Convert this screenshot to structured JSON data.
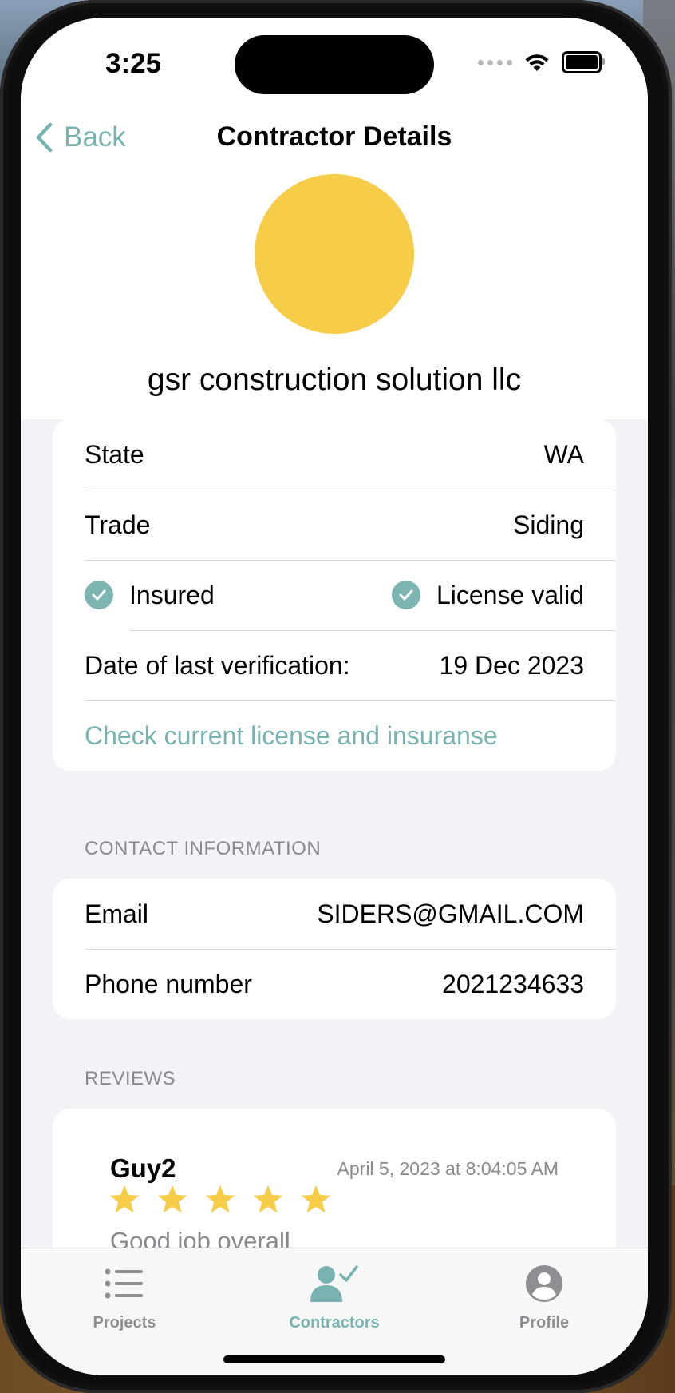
{
  "status_bar": {
    "time": "3:25"
  },
  "nav": {
    "back_label": "Back",
    "title": "Contractor Details"
  },
  "contractor": {
    "name": "gsr construction solution llc",
    "avatar_color": "#f6cc48"
  },
  "details": {
    "state_label": "State",
    "state_value": "WA",
    "trade_label": "Trade",
    "trade_value": "Siding",
    "insured_label": "Insured",
    "license_label": "License valid",
    "verification_label": "Date of last verification:",
    "verification_value": "19 Dec 2023",
    "check_link": "Check current license and insuranse"
  },
  "contact": {
    "header": "CONTACT INFORMATION",
    "email_label": "Email",
    "email_value": "SIDERS@GMAIL.COM",
    "phone_label": "Phone number",
    "phone_value": "2021234633"
  },
  "reviews": {
    "header": "REVIEWS",
    "items": [
      {
        "author": "Guy2",
        "date": "April 5, 2023 at 8:04:05 AM",
        "rating": 5,
        "text": "Good job overall"
      }
    ]
  },
  "tabbar": {
    "tabs": [
      {
        "label": "Projects",
        "icon": "list-icon",
        "active": false
      },
      {
        "label": "Contractors",
        "icon": "person-check-icon",
        "active": true
      },
      {
        "label": "Profile",
        "icon": "person-circle-icon",
        "active": false
      }
    ]
  },
  "colors": {
    "accent": "#78b3b1",
    "star": "#f6cc48",
    "background": "#f2f2f7"
  }
}
